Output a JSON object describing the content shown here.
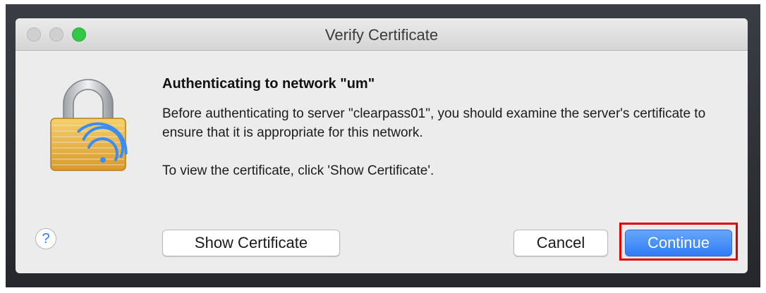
{
  "window": {
    "title": "Verify Certificate"
  },
  "dialog": {
    "heading": "Authenticating to network \"um\"",
    "message": "Before authenticating to server \"clearpass01\", you should examine the server's certificate to ensure that it is appropriate for this network.",
    "instruction": "To view the certificate, click 'Show Certificate'."
  },
  "buttons": {
    "help": "?",
    "show_certificate": "Show Certificate",
    "cancel": "Cancel",
    "continue": "Continue"
  },
  "icons": {
    "dialog_icon": "lock-wifi-icon"
  },
  "colors": {
    "accent": "#2f7cf6",
    "highlight": "#e00000"
  }
}
